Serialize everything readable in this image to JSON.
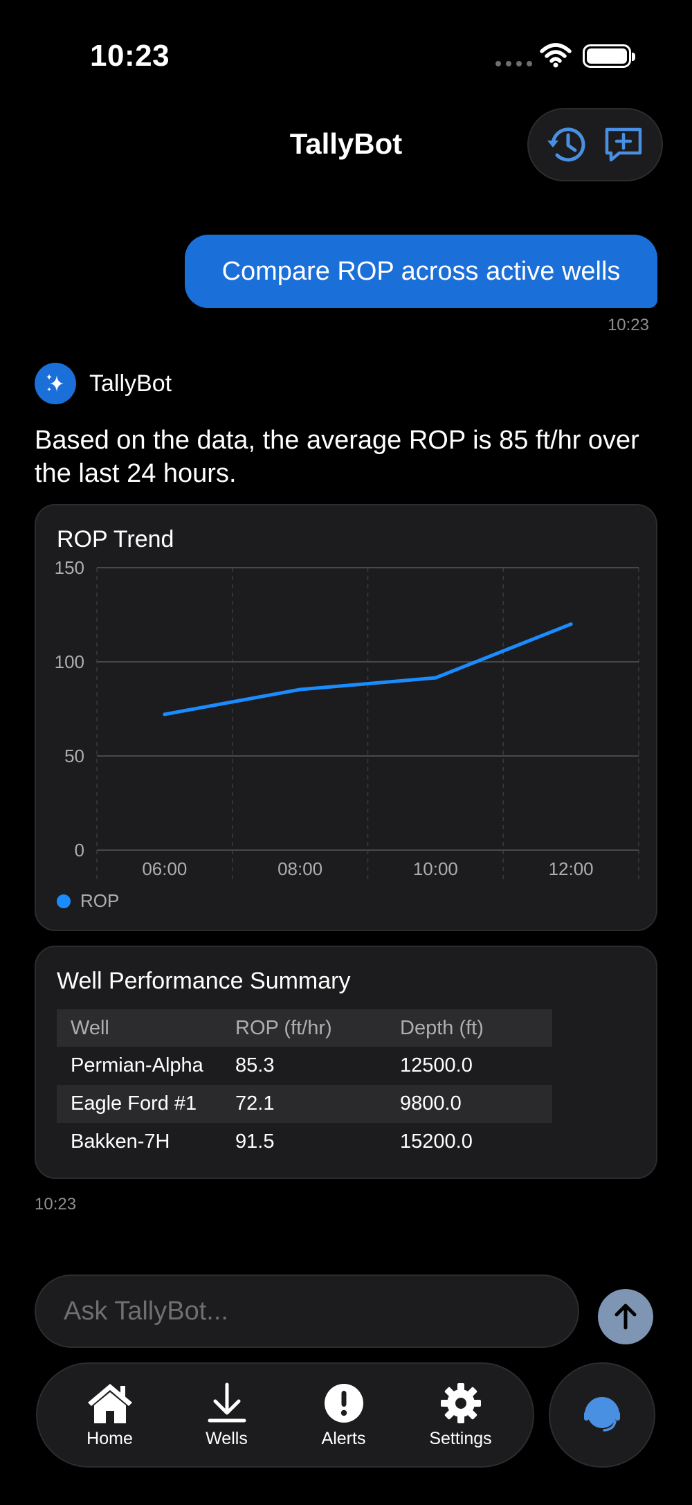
{
  "status_bar": {
    "time": "10:23"
  },
  "header": {
    "title": "TallyBot",
    "history_icon": "history-icon",
    "new_chat_icon": "new-chat-icon"
  },
  "conversation": {
    "user_message": {
      "text": "Compare ROP across active wells",
      "time": "10:23"
    },
    "bot_message": {
      "name": "TallyBot",
      "text": "Based on the data, the average ROP is 85 ft/hr over the last 24 hours.",
      "time": "10:23"
    }
  },
  "chart_card": {
    "title": "ROP Trend",
    "legend_label": "ROP"
  },
  "chart_data": {
    "type": "line",
    "title": "ROP Trend",
    "categories": [
      "06:00",
      "08:00",
      "10:00",
      "12:00"
    ],
    "series": [
      {
        "name": "ROP",
        "values": [
          72.1,
          85.3,
          91.5,
          120
        ]
      }
    ],
    "ylim": [
      0,
      150
    ],
    "yticks": [
      0,
      50,
      100,
      150
    ],
    "grid": true,
    "legend": "bottom-left",
    "colors": {
      "line": "#1a8cff",
      "grid": "#3a3a3c",
      "axis_text": "#aeaeb2"
    }
  },
  "table_card": {
    "title": "Well Performance Summary",
    "headers": [
      "Well",
      "ROP (ft/hr)",
      "Depth (ft)"
    ],
    "rows": [
      [
        "Permian-Alpha",
        "85.3",
        "12500.0"
      ],
      [
        "Eagle Ford #1",
        "72.1",
        "9800.0"
      ],
      [
        "Bakken-7H",
        "91.5",
        "15200.0"
      ]
    ]
  },
  "input": {
    "placeholder": "Ask TallyBot..."
  },
  "tabs": [
    {
      "label": "Home",
      "icon": "home-icon"
    },
    {
      "label": "Wells",
      "icon": "download-icon"
    },
    {
      "label": "Alerts",
      "icon": "alert-icon"
    },
    {
      "label": "Settings",
      "icon": "gear-icon"
    }
  ],
  "colors": {
    "accent": "#1b6fd8",
    "background": "#000000",
    "card": "#1c1c1e",
    "send_button": "#7e95b3"
  }
}
